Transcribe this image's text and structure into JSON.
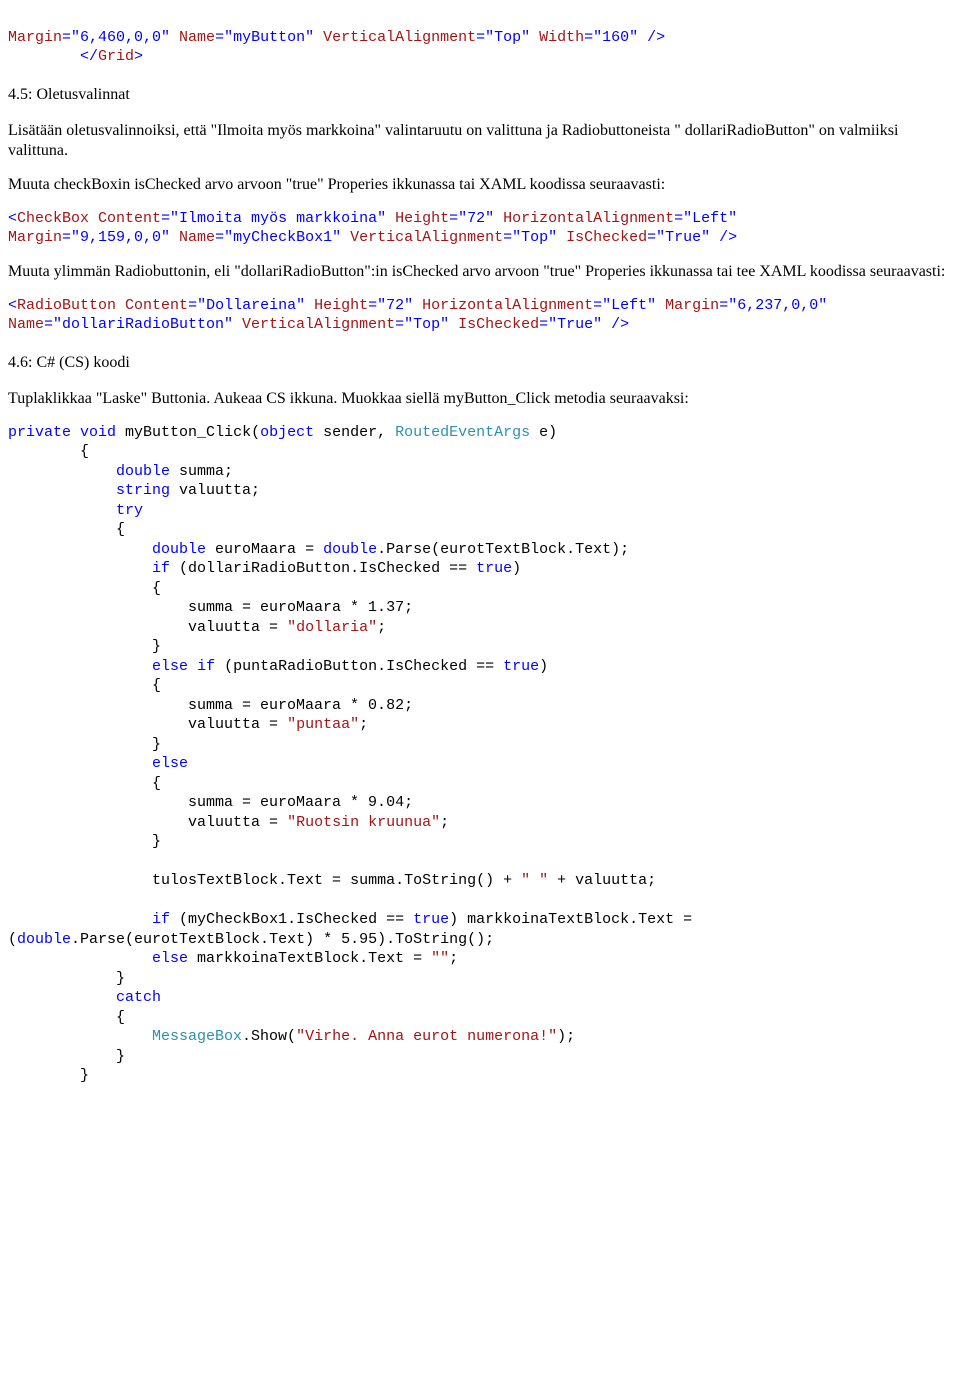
{
  "code_top_1": {
    "a1": "Margin",
    "a2": "=\"6,460,0,0\"",
    "a3": " Name",
    "a4": "=\"myButton\"",
    "a5": " VerticalAlignment",
    "a6": "=\"Top\"",
    "a7": " Width",
    "a8": "=\"160\" />"
  },
  "code_top_2": {
    "t1": "        </",
    "t2": "Grid",
    "t3": ">"
  },
  "heading_45": "4.5: Oletusvalinnat",
  "para_1": "Lisätään oletusvalinnoiksi, että \"Ilmoita myös markkoina\" valintaruutu on valittuna ja Radiobuttoneista \" dollariRadioButton\" on valmiiksi valittuna.",
  "para_2": "Muuta checkBoxin isChecked arvo arvoon \"true\" Properies ikkunassa tai XAML koodissa seuraavasti:",
  "checkbox_code": [
    {
      "c": "blue",
      "t": "<"
    },
    {
      "c": "red",
      "t": "CheckBox"
    },
    {
      "c": "red",
      "t": " Content"
    },
    {
      "c": "blue",
      "t": "=\"Ilmoita myös markkoina\""
    },
    {
      "c": "red",
      "t": " Height"
    },
    {
      "c": "blue",
      "t": "=\"72\""
    },
    {
      "c": "red",
      "t": " HorizontalAlignment"
    },
    {
      "c": "blue",
      "t": "=\"Left\""
    },
    {
      "c": "black",
      "t": "\n"
    },
    {
      "c": "red",
      "t": "Margin"
    },
    {
      "c": "blue",
      "t": "=\"9,159,0,0\""
    },
    {
      "c": "red",
      "t": " Name"
    },
    {
      "c": "blue",
      "t": "=\"myCheckBox1\""
    },
    {
      "c": "red",
      "t": " VerticalAlignment"
    },
    {
      "c": "blue",
      "t": "=\"Top\""
    },
    {
      "c": "red",
      "t": " IsChecked"
    },
    {
      "c": "blue",
      "t": "=\"True\" />"
    }
  ],
  "para_3": "Muuta ylimmän Radiobuttonin, eli \"dollariRadioButton\":in isChecked arvo arvoon \"true\" Properies ikkunassa tai tee XAML koodissa seuraavasti:",
  "radio_code": [
    {
      "c": "blue",
      "t": "<"
    },
    {
      "c": "red",
      "t": "RadioButton"
    },
    {
      "c": "red",
      "t": " Content"
    },
    {
      "c": "blue",
      "t": "=\"Dollareina\""
    },
    {
      "c": "red",
      "t": " Height"
    },
    {
      "c": "blue",
      "t": "=\"72\""
    },
    {
      "c": "red",
      "t": " HorizontalAlignment"
    },
    {
      "c": "blue",
      "t": "=\"Left\""
    },
    {
      "c": "red",
      "t": " Margin"
    },
    {
      "c": "blue",
      "t": "=\"6,237,0,0\""
    },
    {
      "c": "black",
      "t": "\n"
    },
    {
      "c": "red",
      "t": "Name"
    },
    {
      "c": "blue",
      "t": "=\"dollariRadioButton\""
    },
    {
      "c": "red",
      "t": " VerticalAlignment"
    },
    {
      "c": "blue",
      "t": "=\"Top\""
    },
    {
      "c": "red",
      "t": " IsChecked"
    },
    {
      "c": "blue",
      "t": "=\"True\" />"
    }
  ],
  "heading_46": "4.6: C# (CS) koodi",
  "para_4": "Tuplaklikkaa \"Laske\" Buttonia. Aukeaa CS ikkuna. Muokkaa siellä myButton_Click metodia seuraavaksi:",
  "cs": {
    "l01": [
      {
        "c": "blue",
        "t": "private"
      },
      {
        "c": "black",
        "t": " "
      },
      {
        "c": "blue",
        "t": "void"
      },
      {
        "c": "black",
        "t": " myButton_Click("
      },
      {
        "c": "blue",
        "t": "object"
      },
      {
        "c": "black",
        "t": " sender, "
      },
      {
        "c": "teal",
        "t": "RoutedEventArgs"
      },
      {
        "c": "black",
        "t": " e)"
      }
    ],
    "l02": "        {",
    "l03": [
      {
        "c": "black",
        "t": "            "
      },
      {
        "c": "blue",
        "t": "double"
      },
      {
        "c": "black",
        "t": " summa;"
      }
    ],
    "l04": [
      {
        "c": "black",
        "t": "            "
      },
      {
        "c": "blue",
        "t": "string"
      },
      {
        "c": "black",
        "t": " valuutta;"
      }
    ],
    "l05": [
      {
        "c": "black",
        "t": "            "
      },
      {
        "c": "blue",
        "t": "try"
      }
    ],
    "l06": "            {",
    "l07": [
      {
        "c": "black",
        "t": "                "
      },
      {
        "c": "blue",
        "t": "double"
      },
      {
        "c": "black",
        "t": " euroMaara = "
      },
      {
        "c": "blue",
        "t": "double"
      },
      {
        "c": "black",
        "t": ".Parse(eurotTextBlock.Text);"
      }
    ],
    "l08": [
      {
        "c": "black",
        "t": "                "
      },
      {
        "c": "blue",
        "t": "if"
      },
      {
        "c": "black",
        "t": " (dollariRadioButton.IsChecked == "
      },
      {
        "c": "blue",
        "t": "true"
      },
      {
        "c": "black",
        "t": ")"
      }
    ],
    "l09": "                {",
    "l10": "                    summa = euroMaara * 1.37;",
    "l11": [
      {
        "c": "black",
        "t": "                    valuutta = "
      },
      {
        "c": "red",
        "t": "\"dollaria\""
      },
      {
        "c": "black",
        "t": ";"
      }
    ],
    "l12": "                }",
    "l13": [
      {
        "c": "black",
        "t": "                "
      },
      {
        "c": "blue",
        "t": "else"
      },
      {
        "c": "black",
        "t": " "
      },
      {
        "c": "blue",
        "t": "if"
      },
      {
        "c": "black",
        "t": " (puntaRadioButton.IsChecked == "
      },
      {
        "c": "blue",
        "t": "true"
      },
      {
        "c": "black",
        "t": ")"
      }
    ],
    "l14": "                {",
    "l15": "                    summa = euroMaara * 0.82;",
    "l16": [
      {
        "c": "black",
        "t": "                    valuutta = "
      },
      {
        "c": "red",
        "t": "\"puntaa\""
      },
      {
        "c": "black",
        "t": ";"
      }
    ],
    "l17": "                }",
    "l18": [
      {
        "c": "black",
        "t": "                "
      },
      {
        "c": "blue",
        "t": "else"
      }
    ],
    "l19": "                {",
    "l20": "                    summa = euroMaara * 9.04;",
    "l21": [
      {
        "c": "black",
        "t": "                    valuutta = "
      },
      {
        "c": "red",
        "t": "\"Ruotsin kruunua\""
      },
      {
        "c": "black",
        "t": ";"
      }
    ],
    "l22": "                }",
    "l23": "",
    "l24": [
      {
        "c": "black",
        "t": "                tulosTextBlock.Text = summa.ToString() + "
      },
      {
        "c": "red",
        "t": "\" \""
      },
      {
        "c": "black",
        "t": " + valuutta;"
      }
    ],
    "l25": "",
    "l26": [
      {
        "c": "black",
        "t": "                "
      },
      {
        "c": "blue",
        "t": "if"
      },
      {
        "c": "black",
        "t": " (myCheckBox1.IsChecked == "
      },
      {
        "c": "blue",
        "t": "true"
      },
      {
        "c": "black",
        "t": ") markkoinaTextBlock.Text = "
      }
    ],
    "l27": [
      {
        "c": "black",
        "t": "("
      },
      {
        "c": "blue",
        "t": "double"
      },
      {
        "c": "black",
        "t": ".Parse(eurotTextBlock.Text) * 5.95).ToString();"
      }
    ],
    "l28": [
      {
        "c": "black",
        "t": "                "
      },
      {
        "c": "blue",
        "t": "else"
      },
      {
        "c": "black",
        "t": " markkoinaTextBlock.Text = "
      },
      {
        "c": "red",
        "t": "\"\""
      },
      {
        "c": "black",
        "t": ";"
      }
    ],
    "l29": "            }",
    "l30": [
      {
        "c": "black",
        "t": "            "
      },
      {
        "c": "blue",
        "t": "catch"
      }
    ],
    "l31": "            {",
    "l32": [
      {
        "c": "black",
        "t": "                "
      },
      {
        "c": "teal",
        "t": "MessageBox"
      },
      {
        "c": "black",
        "t": ".Show("
      },
      {
        "c": "red",
        "t": "\"Virhe. Anna eurot numerona!\""
      },
      {
        "c": "black",
        "t": ");"
      }
    ],
    "l33": "            }",
    "l34": "        }"
  }
}
